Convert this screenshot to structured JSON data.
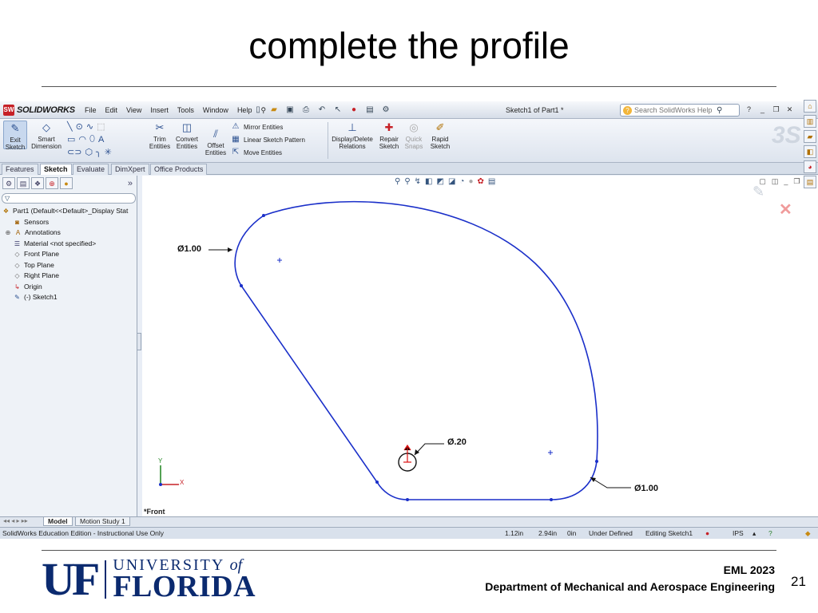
{
  "slide": {
    "title": "complete the profile",
    "course": "EML 2023",
    "department": "Department of Mechanical and Aerospace Engineering",
    "page_number": "21",
    "logo": {
      "mark": "UF",
      "university": "UNIVERSITY",
      "of": "of",
      "state": "FLORIDA"
    }
  },
  "app": {
    "brand": "SOLIDWORKS",
    "menu": [
      "File",
      "Edit",
      "View",
      "Insert",
      "Tools",
      "Window",
      "Help"
    ],
    "document_title": "Sketch1 of Part1 *",
    "search_placeholder": "Search SolidWorks Help"
  },
  "command_manager": {
    "exit_sketch": "Exit Sketch",
    "smart_dimension": "Smart Dimension",
    "trim_entities": "Trim Entities",
    "convert_entities": "Convert Entities",
    "offset_entities": "Offset Entities",
    "mirror_entities": "Mirror Entities",
    "linear_sketch_pattern": "Linear Sketch Pattern",
    "move_entities": "Move Entities",
    "display_delete_relations": "Display/Delete Relations",
    "repair_sketch": "Repair Sketch",
    "quick_snaps": "Quick Snaps",
    "rapid_sketch": "Rapid Sketch"
  },
  "tabs": [
    "Features",
    "Sketch",
    "Evaluate",
    "DimXpert",
    "Office Products"
  ],
  "active_tab": "Sketch",
  "feature_tree": [
    {
      "label": "Part1  (Default<<Default>_Display Stat",
      "icon": "part-icon"
    },
    {
      "label": "Sensors",
      "icon": "sensors-icon"
    },
    {
      "label": "Annotations",
      "icon": "annotations-icon"
    },
    {
      "label": "Material <not specified>",
      "icon": "material-icon"
    },
    {
      "label": "Front Plane",
      "icon": "plane-icon"
    },
    {
      "label": "Top Plane",
      "icon": "plane-icon"
    },
    {
      "label": "Right Plane",
      "icon": "plane-icon"
    },
    {
      "label": "Origin",
      "icon": "origin-icon"
    },
    {
      "label": "(-) Sketch1",
      "icon": "sketch-icon"
    }
  ],
  "bottom_tabs": [
    "Model",
    "Motion Study 1"
  ],
  "view_label": "*Front",
  "dimensions": {
    "top_left": "Ø1.00",
    "bottom_right": "Ø1.00",
    "hole": "Ø.20"
  },
  "status_bar": {
    "edition": "SolidWorks Education Edition - Instructional Use Only",
    "x": "1.12in",
    "y": "2.94in",
    "z": "0in",
    "state": "Under Defined",
    "editing": "Editing Sketch1",
    "units": "IPS"
  },
  "colors": {
    "sketch": "#1a2fc9",
    "dimension": "#111111",
    "uf_blue": "#0b2a6f",
    "sw_red": "#c62127"
  }
}
